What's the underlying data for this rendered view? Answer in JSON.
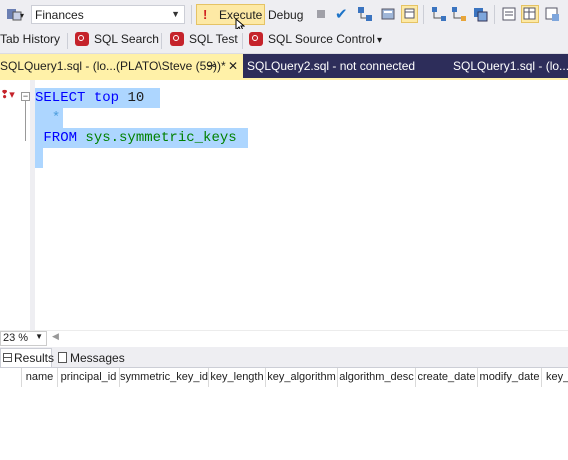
{
  "toolbar": {
    "database": "Finances",
    "execute_label": "Execute",
    "debug_label": "Debug"
  },
  "toolbar2": {
    "items": [
      {
        "label": "Tab History"
      },
      {
        "label": "SQL Search"
      },
      {
        "label": "SQL Test"
      },
      {
        "label": "SQL Source Control"
      }
    ]
  },
  "tabs": {
    "active": "SQLQuery1.sql - (lo...(PLATO\\Steve (59))*",
    "second": "SQLQuery2.sql - not connected",
    "third": "SQLQuery1.sql - (lo..."
  },
  "editor": {
    "line1_kw1": "SELECT",
    "line1_kw2": "top",
    "line1_num": "10",
    "line2": "*",
    "line3_kw": "FROM",
    "line3_obj": "sys.symmetric_keys"
  },
  "zoom": "23 %",
  "results_tabs": {
    "results": "Results",
    "messages": "Messages"
  },
  "grid": {
    "columns": [
      "name",
      "principal_id",
      "symmetric_key_id",
      "key_length",
      "key_algorithm",
      "algorithm_desc",
      "create_date",
      "modify_date",
      "key_"
    ]
  },
  "colors": {
    "execute_bg": "#fde9a5",
    "tabbar_bg": "#2d2d5a",
    "active_tab_bg": "#fff1a8",
    "selection": "#add6ff"
  }
}
